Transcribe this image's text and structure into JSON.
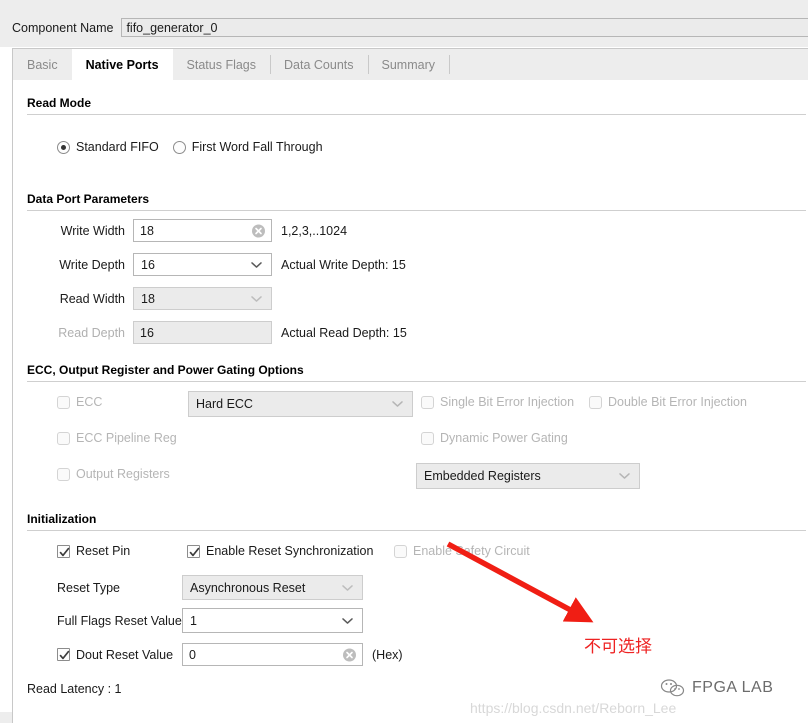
{
  "header": {
    "component_name_label": "Component Name",
    "component_name_value": "fifo_generator_0"
  },
  "tabs": [
    {
      "label": "Basic",
      "active": false
    },
    {
      "label": "Native Ports",
      "active": true
    },
    {
      "label": "Status Flags",
      "active": false
    },
    {
      "label": "Data Counts",
      "active": false
    },
    {
      "label": "Summary",
      "active": false
    }
  ],
  "read_mode": {
    "section_title": "Read Mode",
    "options": [
      {
        "label": "Standard FIFO",
        "checked": true
      },
      {
        "label": "First Word Fall Through",
        "checked": false
      }
    ]
  },
  "data_port": {
    "section_title": "Data Port Parameters",
    "write_width": {
      "label": "Write Width",
      "value": "18",
      "hint": "1,2,3,..1024",
      "disabled": false
    },
    "write_depth": {
      "label": "Write Depth",
      "value": "16",
      "hint": "Actual Write Depth: 15",
      "disabled": false
    },
    "read_width": {
      "label": "Read Width",
      "value": "18",
      "hint": "",
      "disabled": true
    },
    "read_depth": {
      "label": "Read Depth",
      "value": "16",
      "hint": "Actual Read Depth: 15",
      "disabled": true
    }
  },
  "ecc": {
    "section_title": "ECC, Output Register and Power Gating Options",
    "ecc_checkbox": {
      "label": "ECC",
      "checked": false,
      "disabled": true
    },
    "ecc_mode_combo": {
      "value": "Hard ECC",
      "disabled": true
    },
    "single_bit": {
      "label": "Single Bit Error Injection",
      "checked": false,
      "disabled": true
    },
    "double_bit": {
      "label": "Double Bit Error Injection",
      "checked": false,
      "disabled": true
    },
    "ecc_pipeline": {
      "label": "ECC Pipeline Reg",
      "checked": false,
      "disabled": true
    },
    "dynamic_power_gating": {
      "label": "Dynamic Power Gating",
      "checked": false,
      "disabled": true
    },
    "output_registers": {
      "label": "Output Registers",
      "checked": false,
      "disabled": true
    },
    "registers_combo": {
      "value": "Embedded Registers",
      "disabled": true
    }
  },
  "initialization": {
    "section_title": "Initialization",
    "reset_pin": {
      "label": "Reset Pin",
      "checked": true,
      "disabled": false
    },
    "enable_reset_sync": {
      "label": "Enable Reset Synchronization",
      "checked": true,
      "disabled": false
    },
    "enable_safety_circuit": {
      "label": "Enable Safety Circuit",
      "checked": false,
      "disabled": true
    },
    "reset_type": {
      "label": "Reset Type",
      "value": "Asynchronous Reset",
      "disabled": true
    },
    "full_flags_reset_value": {
      "label": "Full Flags Reset Value",
      "value": "1",
      "disabled": false
    },
    "dout_reset_value": {
      "label": "Dout Reset Value",
      "checked": true,
      "value": "0",
      "suffix": "(Hex)",
      "disabled": false
    },
    "read_latency": "Read Latency : 1"
  },
  "annotation": {
    "text": "不可选择",
    "color": "#ee2222"
  },
  "watermark": {
    "brand": "FPGA LAB",
    "url": "https://blog.csdn.net/Reborn_Lee"
  }
}
